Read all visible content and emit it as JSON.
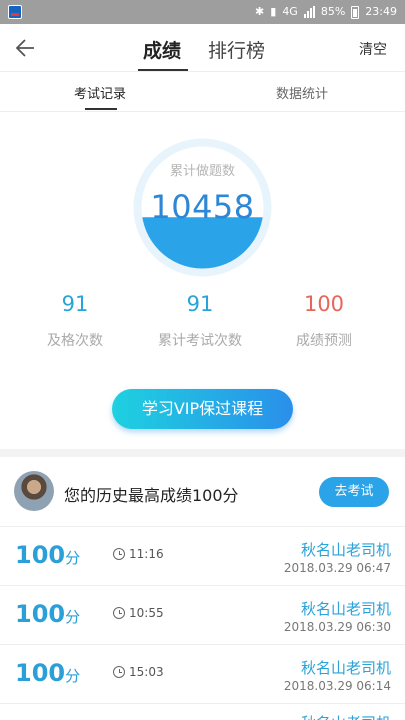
{
  "status_bar": {
    "battery": "85%",
    "time": "23:49",
    "network": "4G"
  },
  "header": {
    "tabs": [
      {
        "label": "成绩",
        "active": true
      },
      {
        "label": "排行榜",
        "active": false
      }
    ],
    "clear_label": "清空"
  },
  "subtabs": [
    {
      "label": "考试记录",
      "active": true
    },
    {
      "label": "数据统计",
      "active": false
    }
  ],
  "summary": {
    "total_label": "累计做题数",
    "total_value": "10458",
    "fill_fraction": 0.42
  },
  "stats": [
    {
      "value": "91",
      "label": "及格次数",
      "color": "#2aa3d8"
    },
    {
      "value": "91",
      "label": "累计考试次数",
      "color": "#2aa3d8"
    },
    {
      "value": "100",
      "label": "成绩预测",
      "color": "#e8655a"
    }
  ],
  "vip_button": "学习VIP保过课程",
  "best": {
    "text": "您的历史最高成绩100分",
    "button": "去考试"
  },
  "records": [
    {
      "score": "100",
      "unit": "分",
      "duration": "11:16",
      "name": "秋名山老司机",
      "date": "2018.03.29 06:47"
    },
    {
      "score": "100",
      "unit": "分",
      "duration": "10:55",
      "name": "秋名山老司机",
      "date": "2018.03.29 06:30"
    },
    {
      "score": "100",
      "unit": "分",
      "duration": "15:03",
      "name": "秋名山老司机",
      "date": "2018.03.29 06:14"
    },
    {
      "score": "",
      "unit": "",
      "duration": "",
      "name": "秋名山老司机",
      "date": ""
    }
  ],
  "colors": {
    "accent": "#2aa3d8",
    "accent_dark": "#2d87d4",
    "red": "#e8655a"
  }
}
